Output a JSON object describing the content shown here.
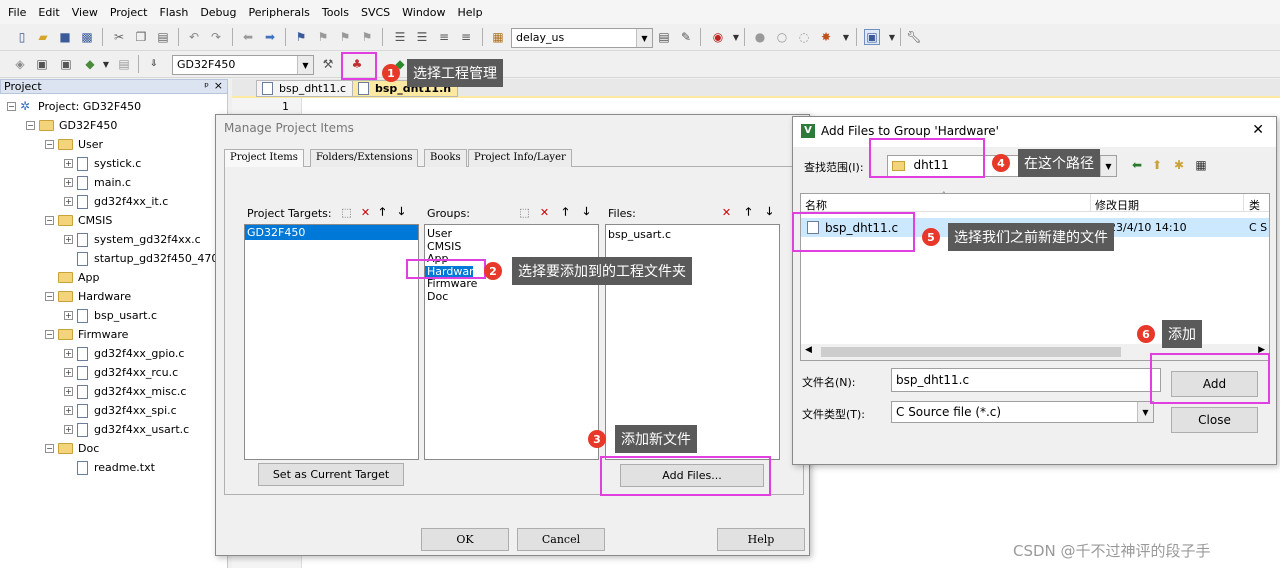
{
  "menu": [
    "File",
    "Edit",
    "View",
    "Project",
    "Flash",
    "Debug",
    "Peripherals",
    "Tools",
    "SVCS",
    "Window",
    "Help"
  ],
  "toolbar": {
    "find_value": "delay_us",
    "target_value": "GD32F450"
  },
  "project_panel": {
    "title": "Project",
    "pin": "ᵖ",
    "close": "×",
    "tree": [
      {
        "label": "Project: GD32F450",
        "kind": "root",
        "level": 0
      },
      {
        "label": "GD32F450",
        "kind": "folder",
        "level": 1
      },
      {
        "label": "User",
        "kind": "folder",
        "level": 2
      },
      {
        "label": "systick.c",
        "kind": "file",
        "level": 3
      },
      {
        "label": "main.c",
        "kind": "file",
        "level": 3
      },
      {
        "label": "gd32f4xx_it.c",
        "kind": "file",
        "level": 3
      },
      {
        "label": "CMSIS",
        "kind": "folder",
        "level": 2
      },
      {
        "label": "system_gd32f4xx.c",
        "kind": "file",
        "level": 3
      },
      {
        "label": "startup_gd32f450_470.s",
        "kind": "file-noexp",
        "level": 3
      },
      {
        "label": "App",
        "kind": "folder-noexp",
        "level": 2
      },
      {
        "label": "Hardware",
        "kind": "folder",
        "level": 2
      },
      {
        "label": "bsp_usart.c",
        "kind": "file",
        "level": 3
      },
      {
        "label": "Firmware",
        "kind": "folder",
        "level": 2
      },
      {
        "label": "gd32f4xx_gpio.c",
        "kind": "file",
        "level": 3
      },
      {
        "label": "gd32f4xx_rcu.c",
        "kind": "file",
        "level": 3
      },
      {
        "label": "gd32f4xx_misc.c",
        "kind": "file",
        "level": 3
      },
      {
        "label": "gd32f4xx_spi.c",
        "kind": "file",
        "level": 3
      },
      {
        "label": "gd32f4xx_usart.c",
        "kind": "file",
        "level": 3
      },
      {
        "label": "Doc",
        "kind": "folder",
        "level": 2
      },
      {
        "label": "readme.txt",
        "kind": "file-noexp",
        "level": 3
      }
    ]
  },
  "editor": {
    "tabs": [
      "bsp_dht11.c",
      "bsp_dht11.h"
    ],
    "line_number": "1"
  },
  "manage_dialog": {
    "title": "Manage Project Items",
    "tabs": [
      "Project Items",
      "Folders/Extensions",
      "Books",
      "Project Info/Layer"
    ],
    "targets_label": "Project Targets:",
    "targets": [
      "GD32F450"
    ],
    "groups_label": "Groups:",
    "groups": [
      "User",
      "CMSIS",
      "App",
      "Hardware",
      "Firmware",
      "Doc"
    ],
    "files_label": "Files:",
    "files": [
      "bsp_usart.c"
    ],
    "set_target_button": "Set as Current Target",
    "add_files_button": "Add Files...",
    "ok_button": "OK",
    "cancel_button": "Cancel",
    "help_button": "Help"
  },
  "add_dialog": {
    "title": "Add Files to Group 'Hardware'",
    "close": "✕",
    "look_in_label": "查找范围(I):",
    "look_in_value": "dht11",
    "col_name": "名称",
    "col_date": "修改日期",
    "col_type": "类",
    "file_name": "bsp_dht11.c",
    "file_date": "2023/4/10 14:10",
    "file_type": "C S",
    "filename_label": "文件名(N):",
    "filename_value": "bsp_dht11.c",
    "filetype_label": "文件类型(T):",
    "filetype_value": "C Source file (*.c)",
    "add_button": "Add",
    "close_button": "Close"
  },
  "annotations": [
    {
      "num": "1",
      "text": "选择工程管理"
    },
    {
      "num": "2",
      "text": "选择要添加到的工程文件夹"
    },
    {
      "num": "3",
      "text": "添加新文件"
    },
    {
      "num": "4",
      "text": "在这个路径"
    },
    {
      "num": "5",
      "text": "选择我们之前新建的文件"
    },
    {
      "num": "6",
      "text": "添加"
    }
  ],
  "watermark": "CSDN @千不过神评的段子手",
  "colors": {
    "highlight": "#e040e0",
    "badge": "#e8382a",
    "tip_bg": "#5a5a5a",
    "selection": "#0078d7"
  }
}
